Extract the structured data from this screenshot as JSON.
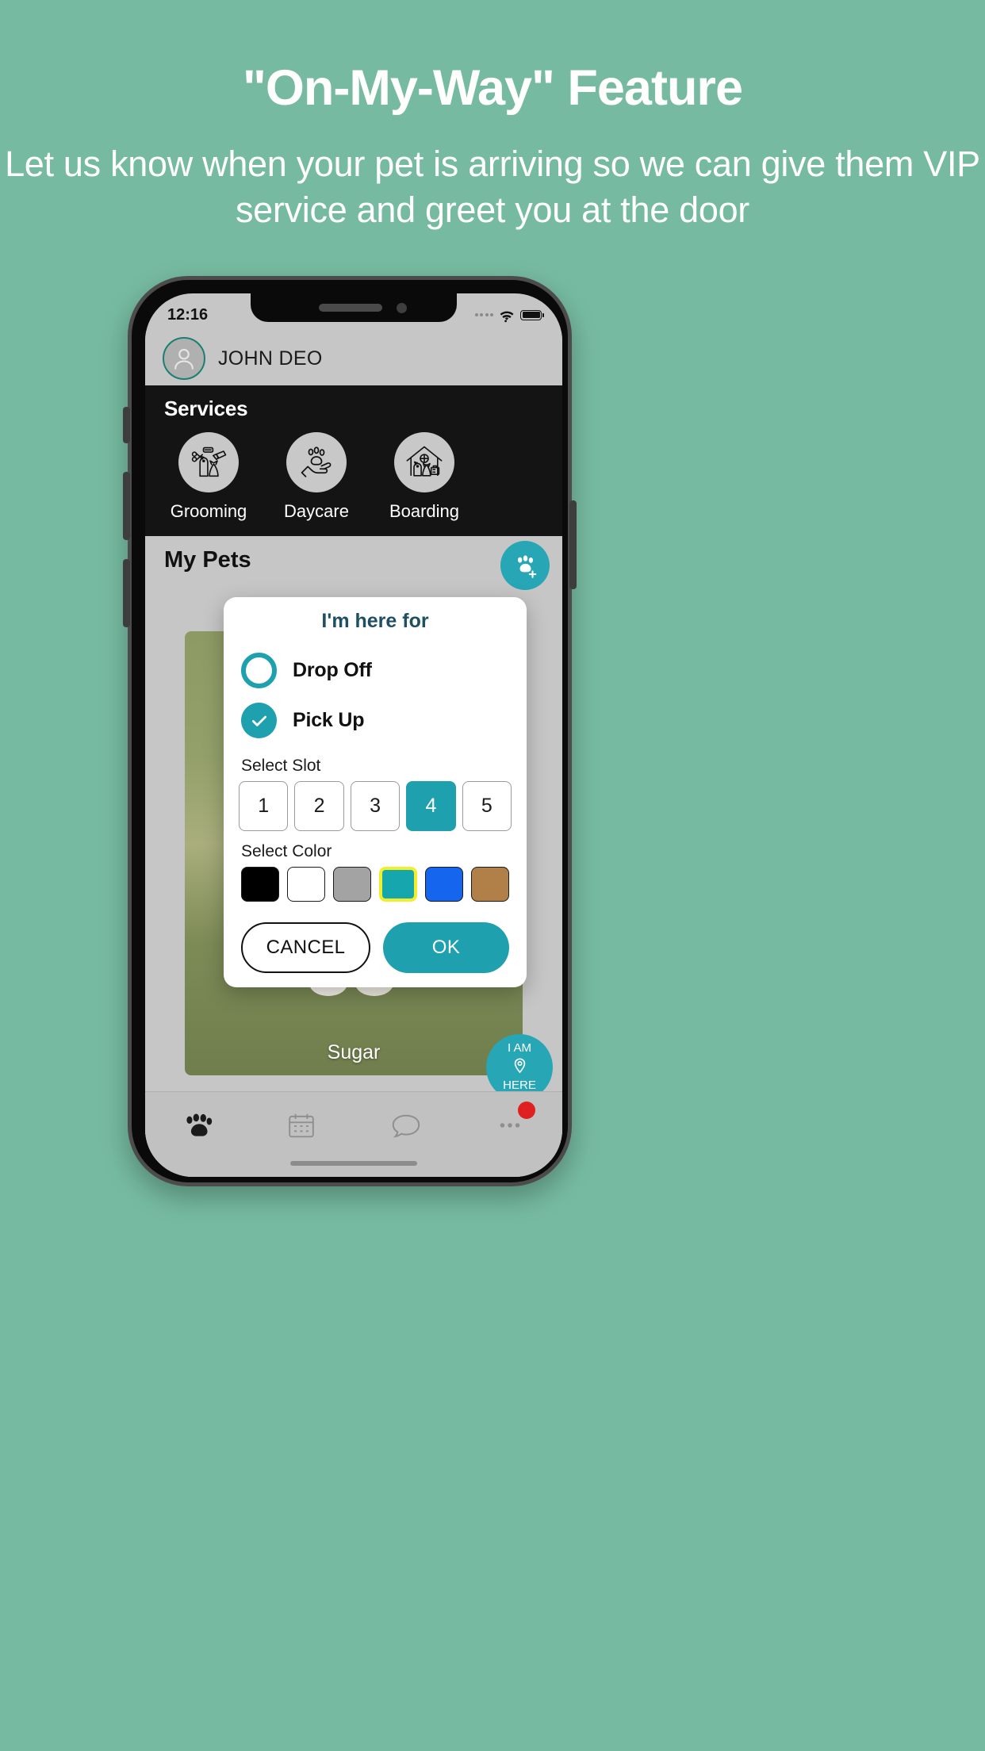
{
  "promo": {
    "title": "\"On-My-Way\" Feature",
    "subtitle": "Let us know when your pet is arriving so we can give them VIP service and greet you at the door"
  },
  "phone": {
    "statusbar": {
      "time": "12:16",
      "wifi_icon": "wifi-icon",
      "battery_icon": "battery-icon",
      "signal_icon": "signal-dots-icon"
    },
    "userbar": {
      "avatar_icon": "user-avatar-icon",
      "name": "JOHN DEO"
    },
    "services": {
      "heading": "Services",
      "items": [
        {
          "label": "Grooming",
          "icon": "grooming-icon"
        },
        {
          "label": "Daycare",
          "icon": "daycare-paw-hand-icon"
        },
        {
          "label": "Boarding",
          "icon": "boarding-house-icon"
        }
      ]
    },
    "content": {
      "section_title": "My Pets",
      "add_pet_icon": "paw-plus-icon",
      "pet_card": {
        "name": "Sugar"
      },
      "i_am_here": {
        "line1": "I AM",
        "line2": "HERE",
        "icon": "location-pin-icon"
      }
    },
    "bottomnav": {
      "items": [
        {
          "name": "pets",
          "icon": "paw-icon",
          "active": true,
          "badge": false
        },
        {
          "name": "calendar",
          "icon": "calendar-icon",
          "active": false,
          "badge": false
        },
        {
          "name": "messages",
          "icon": "chat-bubble-icon",
          "active": false,
          "badge": false
        },
        {
          "name": "more",
          "icon": "ellipsis-icon",
          "active": false,
          "badge": true
        }
      ]
    }
  },
  "dialog": {
    "title": "I'm here for",
    "options": [
      {
        "label": "Drop Off",
        "selected": false
      },
      {
        "label": "Pick Up",
        "selected": true
      }
    ],
    "slot_label": "Select Slot",
    "slots": [
      "1",
      "2",
      "3",
      "4",
      "5"
    ],
    "slot_selected": "4",
    "color_label": "Select Color",
    "colors": [
      {
        "name": "black",
        "hex": "#000000",
        "selected": false
      },
      {
        "name": "white",
        "hex": "#ffffff",
        "selected": false
      },
      {
        "name": "gray",
        "hex": "#a3a3a3",
        "selected": false
      },
      {
        "name": "teal",
        "hex": "#16a7ae",
        "selected": true
      },
      {
        "name": "blue",
        "hex": "#1565ef",
        "selected": false
      },
      {
        "name": "brown",
        "hex": "#b08048",
        "selected": false
      }
    ],
    "color_selected_outline": "#f2ef2a",
    "cancel_label": "CANCEL",
    "ok_label": "OK"
  },
  "theme": {
    "background": "#76bba1",
    "accent": "#1ea0ae",
    "dark_panel": "#141414"
  }
}
